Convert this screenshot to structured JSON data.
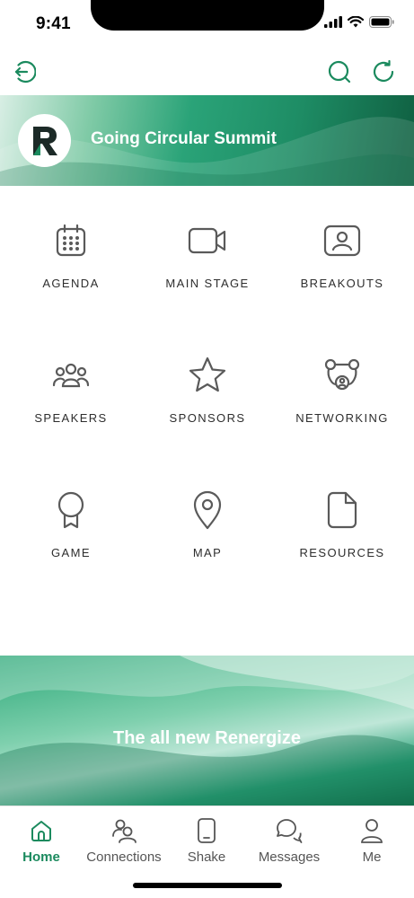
{
  "status_bar": {
    "time": "9:41"
  },
  "event": {
    "title": "Going Circular Summit"
  },
  "menu": [
    {
      "label": "AGENDA",
      "icon": "calendar-icon"
    },
    {
      "label": "MAIN STAGE",
      "icon": "video-icon"
    },
    {
      "label": "BREAKOUTS",
      "icon": "breakout-room-icon"
    },
    {
      "label": "SPEAKERS",
      "icon": "speakers-group-icon"
    },
    {
      "label": "SPONSORS",
      "icon": "star-icon"
    },
    {
      "label": "NETWORKING",
      "icon": "network-icon"
    },
    {
      "label": "GAME",
      "icon": "award-ribbon-icon"
    },
    {
      "label": "MAP",
      "icon": "map-pin-icon"
    },
    {
      "label": "RESOURCES",
      "icon": "document-icon"
    }
  ],
  "promo": {
    "text": "The all new Renergize"
  },
  "tabs": [
    {
      "label": "Home",
      "icon": "home-icon",
      "active": true
    },
    {
      "label": "Connections",
      "icon": "connections-icon",
      "active": false
    },
    {
      "label": "Shake",
      "icon": "phone-shake-icon",
      "active": false
    },
    {
      "label": "Messages",
      "icon": "messages-icon",
      "active": false
    },
    {
      "label": "Me",
      "icon": "profile-icon",
      "active": false
    }
  ],
  "colors": {
    "accent": "#1b8a5e",
    "icon_stroke": "#5a5a5a"
  }
}
